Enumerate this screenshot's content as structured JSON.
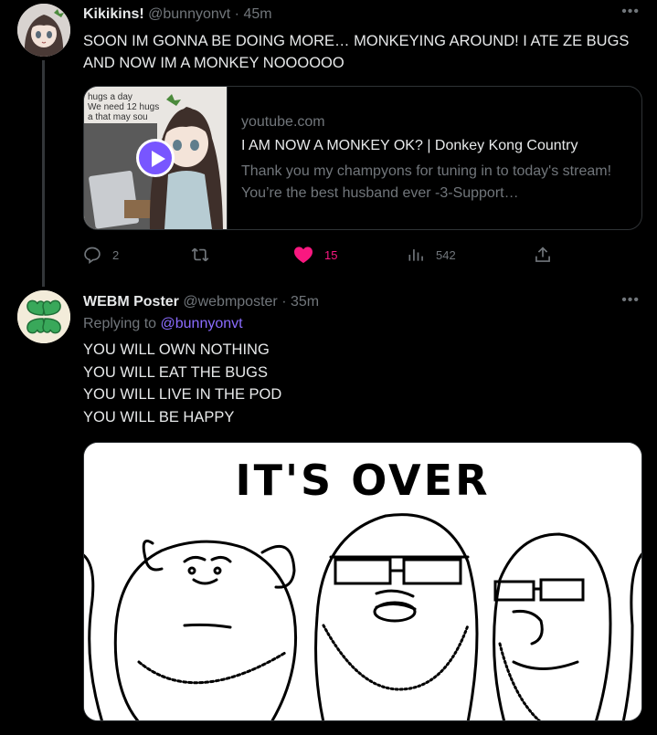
{
  "tweets": [
    {
      "author_name": "Kikikins!",
      "handle": "@bunnyonvt",
      "separator": "·",
      "time": "45m",
      "more_icon": "more-dots-icon",
      "text": "SOON IM GONNA BE DOING MORE… MONKEYING AROUND! I ATE ZE BUGS AND NOW IM A MONKEY NOOOOOO",
      "card": {
        "thumb_text": [
          "hugs a day",
          "We need 12 hugs",
          "a that may sou"
        ],
        "domain": "youtube.com",
        "title": "I AM NOW A MONKEY OK? | Donkey Kong Country",
        "description": "Thank you my champyons for tuning in to today's stream! You’re the best husband ever -3-Support…"
      },
      "actions": {
        "reply_count": "2",
        "retweet_count": "",
        "like_count": "15",
        "views_count": "542"
      }
    },
    {
      "author_name": "WEBM Poster",
      "handle": "@webmposter",
      "separator": "·",
      "time": "35m",
      "replying_prefix": "Replying to",
      "replying_to": "@bunnyonvt",
      "text_lines": [
        "YOU WILL OWN NOTHING",
        "YOU WILL EAT THE BUGS",
        "YOU WILL LIVE IN THE POD",
        "YOU WILL BE HAPPY"
      ],
      "media_caption": "IT'S OVER"
    }
  ],
  "colors": {
    "background": "#000000",
    "text": "#e7e9ea",
    "muted": "#71767b",
    "like_pink": "#f91880",
    "mention": "#8b6cff",
    "border": "#2f3336"
  }
}
